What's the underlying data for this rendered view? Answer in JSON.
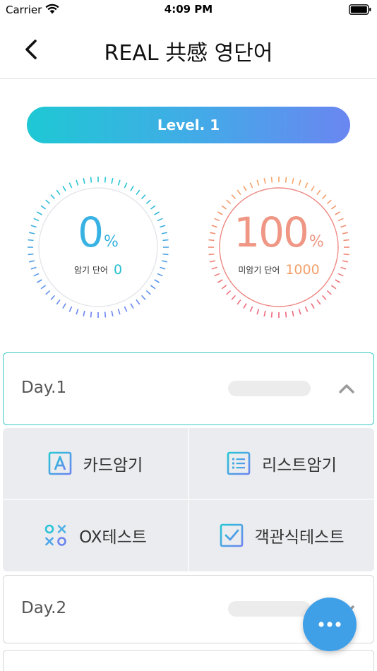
{
  "status_bar": {
    "carrier": "Carrier",
    "time": "4:09 PM"
  },
  "nav": {
    "title": "REAL 共感 영단어",
    "back_icon": "chevron-left-icon"
  },
  "level": {
    "label": "Level. 1"
  },
  "gauges": {
    "memorized": {
      "percent": "0",
      "unit": "%",
      "label": "암기 단어",
      "count": "0",
      "fraction": 0.0,
      "color": "#38b2e3"
    },
    "unmemorized": {
      "percent": "100",
      "unit": "%",
      "label": "미암기 단어",
      "count": "1000",
      "fraction": 1.0,
      "color": "#ef9684"
    }
  },
  "days": [
    {
      "label": "Day.1",
      "expanded": true,
      "progress": 0.0,
      "chevron_icon": "chevron-up-icon"
    },
    {
      "label": "Day.2",
      "expanded": false,
      "progress": 0.0,
      "chevron_icon": "chevron-down-icon"
    }
  ],
  "study_modes": [
    {
      "label": "카드암기",
      "icon": "card-letter-a-icon"
    },
    {
      "label": "리스트암기",
      "icon": "list-icon"
    },
    {
      "label": "OX테스트",
      "icon": "ox-icon"
    },
    {
      "label": "객관식테스트",
      "icon": "checkbox-icon"
    }
  ],
  "fab": {
    "icon": "more-dots-icon"
  },
  "colors": {
    "accent_teal": "#3cc9c8",
    "accent_blue": "#3fa0e8",
    "level_gradient_start": "#1ec8d4",
    "level_gradient_end": "#6a86f1",
    "grid_background": "#eaecef"
  }
}
